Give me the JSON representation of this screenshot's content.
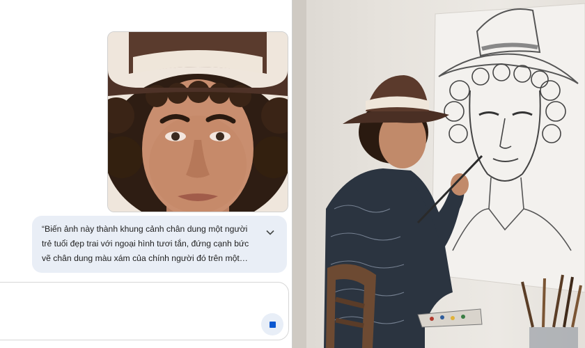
{
  "chat": {
    "prompt_text": "“Biến ảnh này thành khung cảnh chân dung một người trẻ tuổi đẹp trai với ngoại hình tươi tắn, đứng cạnh bức vẽ chân dung màu xám của chính người đó trên một bức tường",
    "expand_icon": "chevron-down-icon",
    "stop_icon": "stop-icon"
  },
  "colors": {
    "bubble": "#e9eef6",
    "accent": "#0b57d0"
  }
}
